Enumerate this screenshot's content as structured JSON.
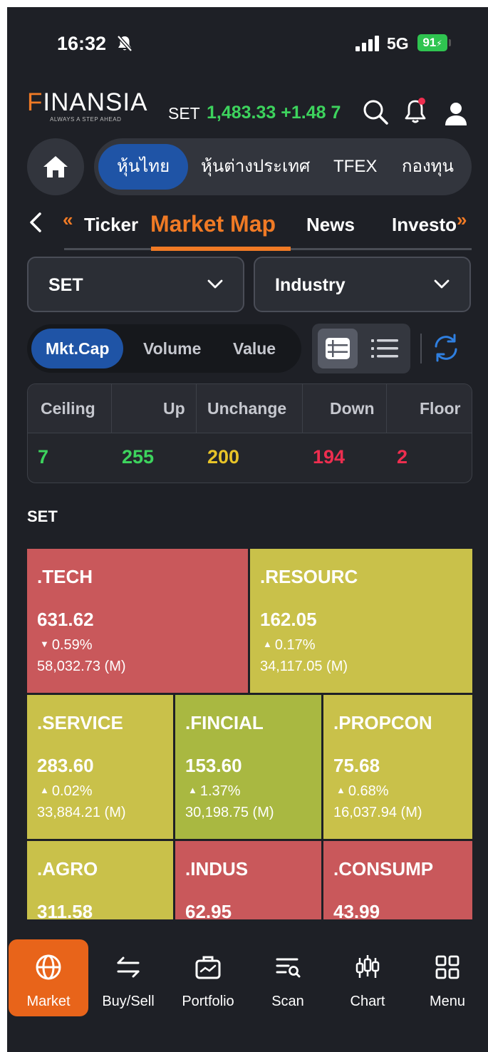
{
  "status_bar": {
    "time": "16:32",
    "network": "5G",
    "battery": "91"
  },
  "header": {
    "logo_first": "F",
    "logo_rest": "INANSIA",
    "tagline": "ALWAYS A STEP AHEAD",
    "index_name": "SET",
    "index_value": "1,483.33 +1.48 7"
  },
  "main_tabs": [
    "หุ้นไทย",
    "หุ้นต่างประเทศ",
    "TFEX",
    "กองทุน"
  ],
  "sub_tabs": {
    "ticker": "Ticker",
    "market_map": "Market Map",
    "news": "News",
    "investor": "Investo"
  },
  "filters": {
    "market": "SET",
    "group": "Industry"
  },
  "modes": [
    "Mkt.Cap",
    "Volume",
    "Value"
  ],
  "breadth": {
    "headers": [
      "Ceiling",
      "Up",
      "Unchange",
      "Down",
      "Floor"
    ],
    "values": [
      "7",
      "255",
      "200",
      "194",
      "2"
    ]
  },
  "section_title": "SET",
  "tiles": [
    {
      "name": ".TECH",
      "value": "631.62",
      "change": "0.59%",
      "dir": "down",
      "mcap": "58,032.73 (M)"
    },
    {
      "name": ".RESOURC",
      "value": "162.05",
      "change": "0.17%",
      "dir": "up",
      "mcap": "34,117.05 (M)"
    },
    {
      "name": ".SERVICE",
      "value": "283.60",
      "change": "0.02%",
      "dir": "up",
      "mcap": "33,884.21 (M)"
    },
    {
      "name": ".FINCIAL",
      "value": "153.60",
      "change": "1.37%",
      "dir": "up",
      "mcap": "30,198.75 (M)"
    },
    {
      "name": ".PROPCON",
      "value": "75.68",
      "change": "0.68%",
      "dir": "up",
      "mcap": "16,037.94 (M)"
    },
    {
      "name": ".AGRO",
      "value": "311.58"
    },
    {
      "name": ".INDUS",
      "value": "62.95"
    },
    {
      "name": ".CONSUMP",
      "value": "43.99"
    }
  ],
  "bottom_nav": [
    "Market",
    "Buy/Sell",
    "Portfolio",
    "Scan",
    "Chart",
    "Menu"
  ],
  "colors": {
    "accent": "#f07a25",
    "primary": "#1f54a6",
    "up": "#3dd35d",
    "unchange": "#e8c428",
    "down": "#ee2e4f",
    "tile_red": "#c9585b",
    "tile_yellow": "#c9c14a",
    "tile_green": "#a9b841"
  }
}
